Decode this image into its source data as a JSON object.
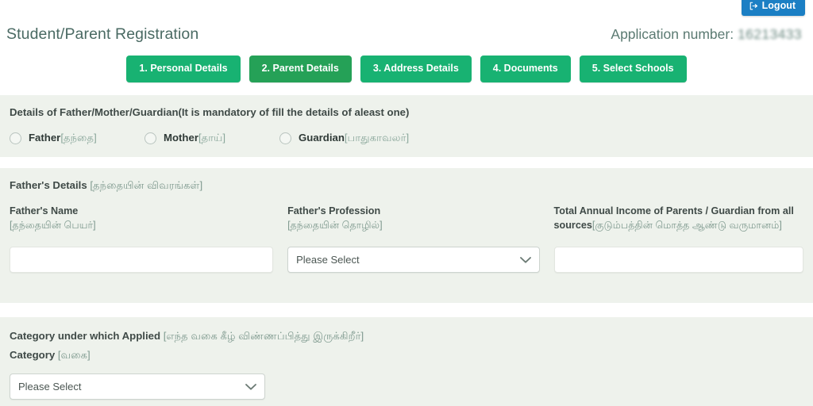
{
  "topbar": {
    "logout_label": "Logout",
    "logout_icon": "sign-out-icon",
    "logout_color": "#1b7fc4"
  },
  "header": {
    "title": "Student/Parent Registration",
    "application_label": "Application number:",
    "application_number": "16213433"
  },
  "steps": {
    "active_index": 1,
    "items": [
      {
        "label": "1. Personal Details"
      },
      {
        "label": "2. Parent Details"
      },
      {
        "label": "3. Address Details"
      },
      {
        "label": "4. Documents"
      },
      {
        "label": "5. Select Schools"
      }
    ],
    "color": "#18b272",
    "active_color": "#25a157"
  },
  "guardian_section": {
    "heading": "Details of Father/Mother/Guardian(It is mandatory of fill the details of aleast one)",
    "options": [
      {
        "label": "Father",
        "label_ta": "[தந்தை]",
        "selected": false
      },
      {
        "label": "Mother",
        "label_ta": "[தாய்]",
        "selected": false
      },
      {
        "label": "Guardian",
        "label_ta": "[பாதுகாவலர்]",
        "selected": false
      }
    ]
  },
  "father_section": {
    "heading": "Father's Details ",
    "heading_ta": "[தந்தையின் விவரங்கள்]",
    "fields": [
      {
        "label": "Father's Name",
        "label_ta": "[தந்தையின் பெயர்]",
        "type": "text",
        "value": ""
      },
      {
        "label": "Father's Profession",
        "label_ta": "[தந்தையின் தொழில்]",
        "type": "select",
        "value": "Please Select"
      },
      {
        "label": "Total Annual Income of Parents / Guardian from all sources",
        "label_ta": "[குடும்பத்தின் மொத்த ஆண்டு வருமானம்]",
        "type": "text",
        "value": ""
      }
    ]
  },
  "category_section": {
    "heading": "Category under which Applied ",
    "heading_ta": "[எந்த வகை கீழ் விண்ணப்பித்து இருக்கிறீர்]",
    "label": "Category ",
    "label_ta": "[வகை]",
    "select_value": "Please Select"
  },
  "colors": {
    "panel_bg": "#eef2ec",
    "page_bg": "#ffffff",
    "title": "#4a6a63",
    "tamil_text": "#7f9a8f"
  }
}
